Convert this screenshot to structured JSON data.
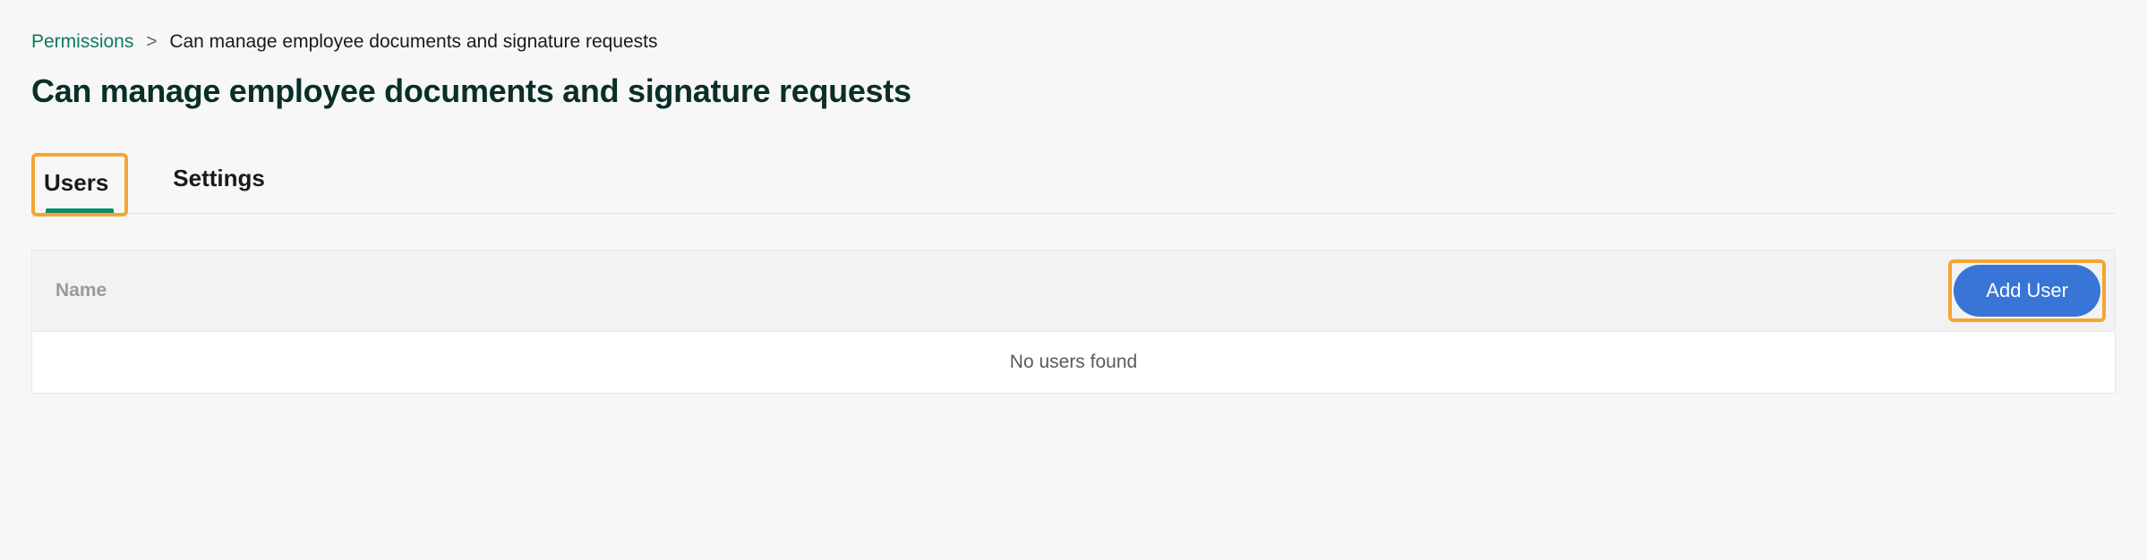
{
  "breadcrumb": {
    "root": "Permissions",
    "separator": ">",
    "current": "Can manage employee documents and signature requests"
  },
  "page_title": "Can manage employee documents and signature requests",
  "tabs": {
    "users": "Users",
    "settings": "Settings"
  },
  "table": {
    "column_name": "Name",
    "add_user_label": "Add User",
    "empty_message": "No users found"
  }
}
